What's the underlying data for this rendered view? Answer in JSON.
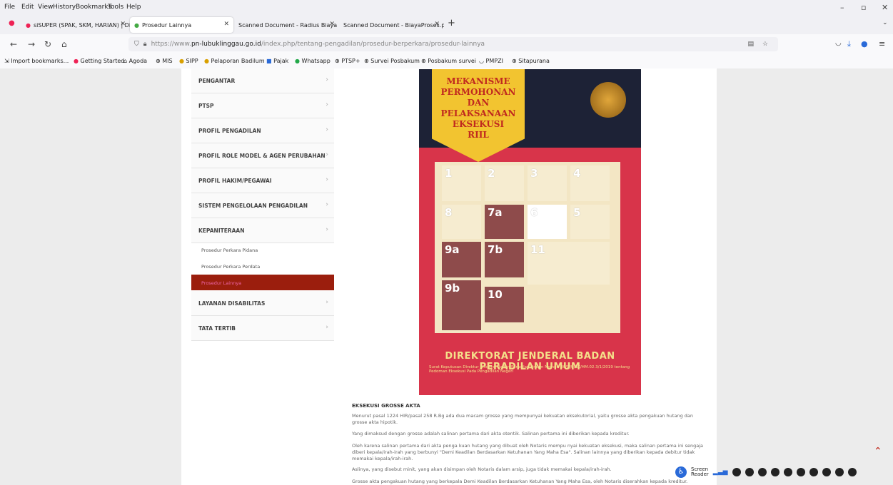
{
  "menu": [
    "File",
    "Edit",
    "View",
    "History",
    "Bookmarks",
    "Tools",
    "Help"
  ],
  "tabs": [
    {
      "title": "siSUPER (SPAK, SKM, HARIAN) | Dir"
    },
    {
      "title": "Prosedur Lainnya"
    },
    {
      "title": "Scanned Document - Radius Biaya"
    },
    {
      "title": "Scanned Document - BiayaProses.p"
    }
  ],
  "url": {
    "prefix": "https://www.",
    "host": "pn-lubuklinggau.go.id",
    "path": "/index.php/tentang-pengadilan/prosedur-berperkara/prosedur-lainnya"
  },
  "bookmarks": [
    "Import bookmarks...",
    "Getting Started",
    "Agoda",
    "MIS",
    "SIPP",
    "Pelaporan Badilum",
    "Pajak",
    "Whatsapp",
    "PTSP+",
    "Survei Posbakum",
    "Posbakum survei",
    "PMPZI",
    "Sitapurana"
  ],
  "sidebar": {
    "items": [
      "PENGANTAR",
      "PTSP",
      "PROFIL PENGADILAN",
      "PROFIL ROLE MODEL & AGEN PERUBAHAN",
      "PROFIL HAKIM/PEGAWAI",
      "SISTEM PENGELOLAAN PENGADILAN",
      "KEPANITERAAN"
    ],
    "subitems": [
      "Prosedur Perkara Pidana",
      "Prosedur Perkara Perdata",
      "Prosedur Lainnya"
    ],
    "items_after": [
      "LAYANAN DISABILITAS",
      "TATA TERTIB"
    ]
  },
  "poster": {
    "title": [
      "MEKANISME",
      "PERMOHONAN DAN",
      "PELAKSANAAN",
      "EKSEKUSI",
      "RIIL"
    ],
    "cells": [
      "1",
      "2",
      "3",
      "4",
      "8",
      "7a",
      "6",
      "5",
      "9a",
      "7b",
      "11",
      "9b",
      "10"
    ],
    "footer": "DIREKTORAT JENDERAL BADAN PERADILAN UMUM",
    "footer_sub": "Surat Keputusan Direktur Jenderal Badan Peradilan Umum Nomor: 40/DJU/SK/HM.02.3/1/2019 tentang Pedoman Eksekusi Pada Pengadilan Negeri"
  },
  "article": {
    "heading": "EKSEKUSI GROSSE AKTA",
    "p1": "Menurut pasal 1224 HIR/pasal 258 R.Bg ada dua macam grosse yang mempunyai kekuatan eksekutorial, yaitu grosse akta pengakuan hutang dan grosse akta hipotik.",
    "p2": "Yang dimaksud dengan grosse adalah salinan pertama dari akta otentik. Salinan pertama ini diberikan kepada kreditur.",
    "p3": "Oleh karena salinan pertama dari akta penga kuan hutang yang dibuat oleh Notaris mempu nyai kekuatan eksekusi, maka salinan pertama ini sengaja diberi kepala/irah-irah yang berbunyi \"Demi Keadilan Berdasarkan Ketuhanan Yang Maha Esa\". Salinan lainnya yang diberikan kepada debitur tidak memakai kepala/irah-irah.",
    "p4": "Aslinya, yang disebut minit, yang akan disimpan oleh Notaris dalam arsip, juga tidak memakai kepala/irah-irah.",
    "p5": "Grosse akta pengakuan hutang yang berkepala Demi Keadilan Berdasarkan Ketuhanan Yang Maha Esa, oleh Notaris diserahkan kepada kreditur."
  },
  "screen_reader": {
    "label1": "Screen",
    "label2": "Reader"
  }
}
